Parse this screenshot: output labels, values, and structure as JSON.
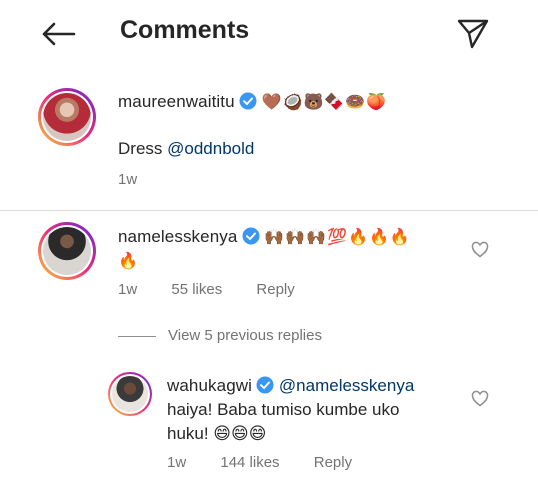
{
  "header": {
    "title": "Comments",
    "back_icon": "arrow-left-icon",
    "send_icon": "send-icon"
  },
  "comments": [
    {
      "username": "maureenwaititu",
      "verified": true,
      "emoji": "🤎🥥🐻🍫🍩🍑",
      "text_prefix": "Dress ",
      "mention": "@oddnbold",
      "time": "1w"
    },
    {
      "username": "namelesskenya",
      "verified": true,
      "emoji": "🙌🏾🙌🏾🙌🏾💯🔥🔥🔥",
      "emoji_line2": "🔥",
      "time": "1w",
      "likes": "55 likes",
      "reply": "Reply"
    }
  ],
  "view_replies": "View 5 previous replies",
  "reply": {
    "username": "wahukagwi",
    "verified": true,
    "mention": "@namelesskenya",
    "text_line1": "haiya! Baba tumiso kumbe uko",
    "text_line2": "huku! 😄😄😄",
    "time": "1w",
    "likes": "144 likes",
    "reply": "Reply"
  },
  "colors": {
    "verified_blue": "#3897f0",
    "mention": "#00376b",
    "meta": "#737373"
  }
}
